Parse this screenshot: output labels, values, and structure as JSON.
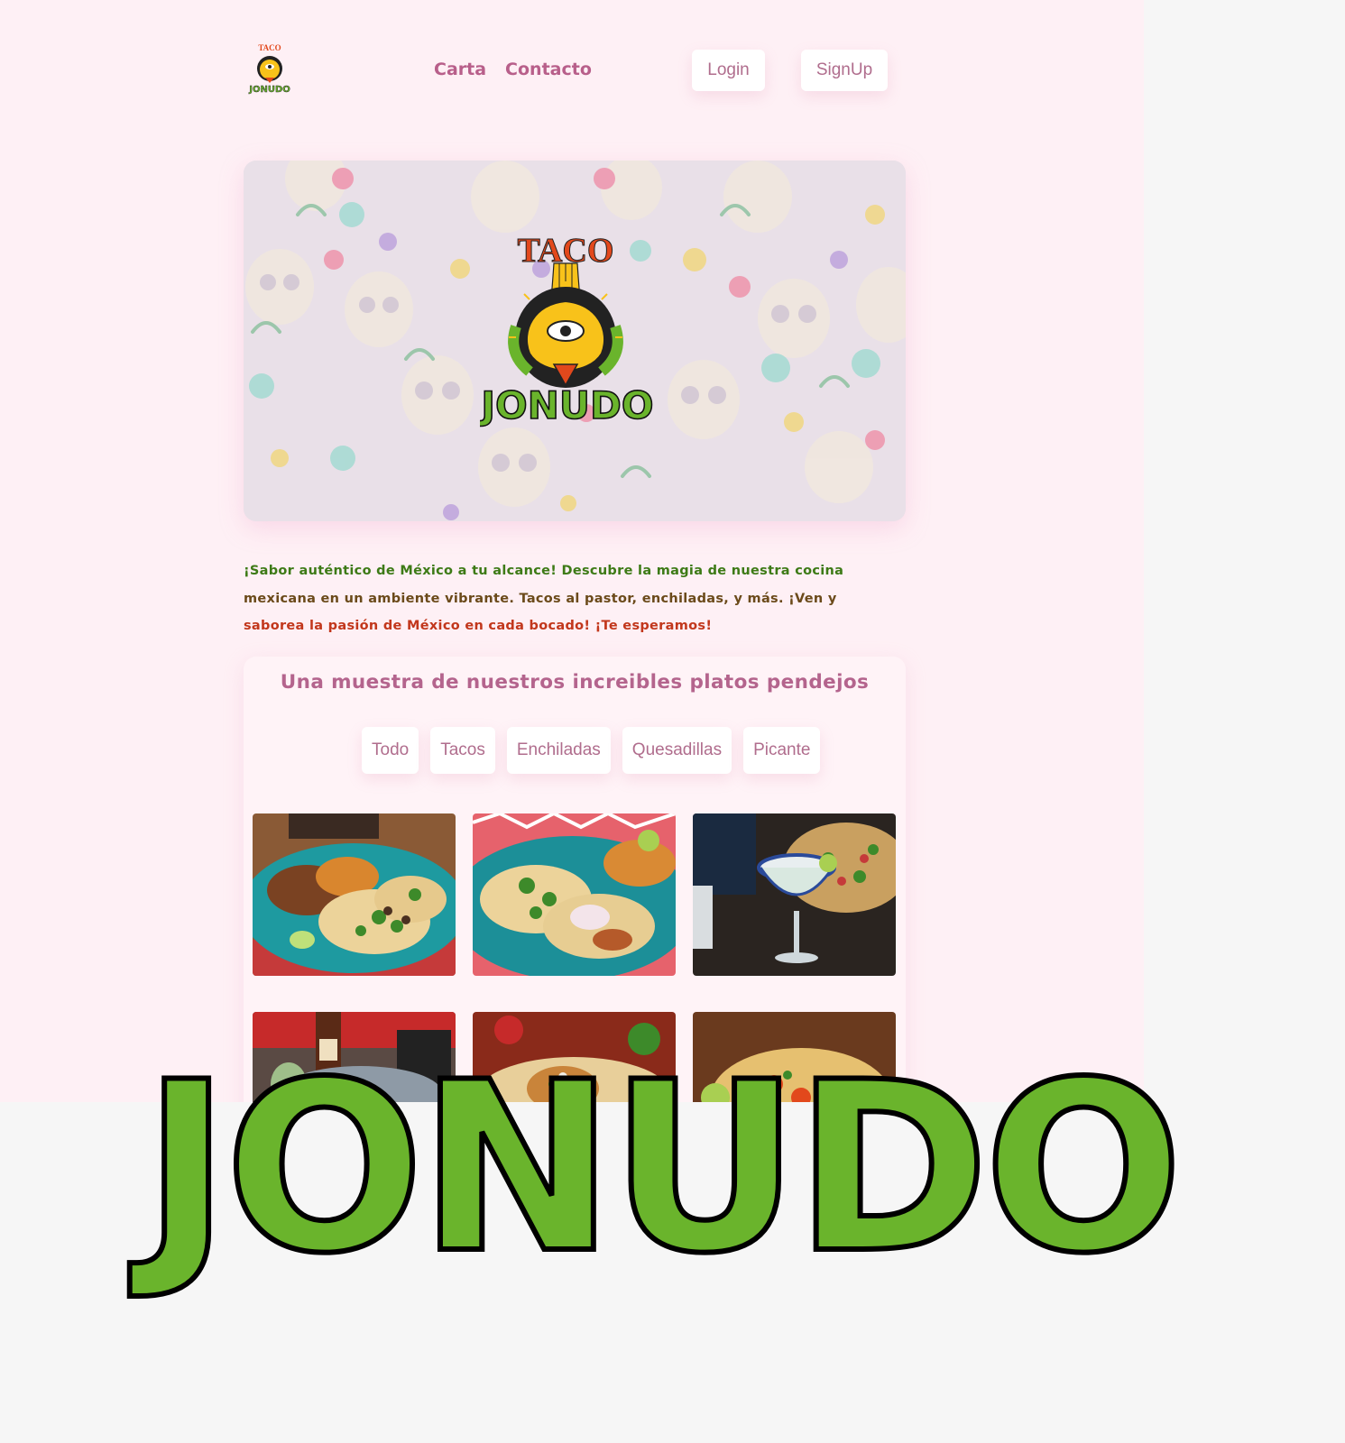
{
  "brand": {
    "word_top": "TACO",
    "word_bottom": "JONUDO"
  },
  "nav": {
    "items": [
      {
        "label": "Carta"
      },
      {
        "label": "Contacto"
      }
    ]
  },
  "auth": {
    "login_label": "Login",
    "signup_label": "SignUp"
  },
  "tagline": {
    "line1": "¡Sabor auténtico de México a tu alcance! Descubre la magia de nuestra cocina",
    "line2": "mexicana en un ambiente vibrante. Tacos al pastor, enchiladas, y más. ¡Ven y",
    "line3": "saborea la pasión de México en cada bocado! ¡Te esperamos!"
  },
  "gallery": {
    "title": "Una muestra de nuestros increibles platos pendejos",
    "filters": [
      {
        "label": "Todo"
      },
      {
        "label": "Tacos"
      },
      {
        "label": "Enchiladas"
      },
      {
        "label": "Quesadillas"
      },
      {
        "label": "Picante"
      }
    ]
  },
  "colors": {
    "page_bg": "#fef0f5",
    "outer_bg": "#f6f6f6",
    "accent": "#b85f8a",
    "green": "#6ab42c",
    "orange": "#e2481c",
    "yellow": "#f8c21a"
  }
}
